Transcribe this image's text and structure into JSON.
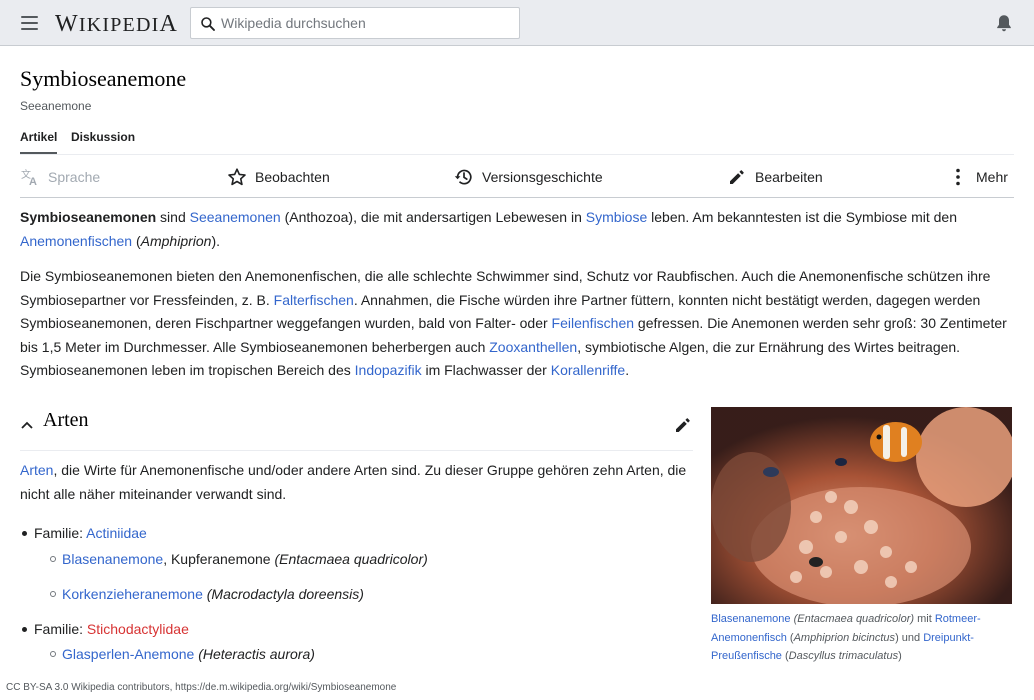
{
  "header": {
    "logo_text": "Wikipedia",
    "search_placeholder": "Wikipedia durchsuchen"
  },
  "page": {
    "title": "Symbioseanemone",
    "tagline": "Seeanemone"
  },
  "tabs": [
    {
      "label": "Artikel",
      "active": true
    },
    {
      "label": "Diskussion",
      "active": false
    }
  ],
  "actions": {
    "language": "Sprache",
    "watch": "Beobachten",
    "history": "Versionsgeschichte",
    "edit": "Bearbeiten",
    "more": "Mehr"
  },
  "intro": {
    "p1": {
      "bold": "Symbioseanemonen",
      "t1": " sind ",
      "l1": "Seeanemonen",
      "t2": " (Anthozoa), die mit andersartigen Lebewesen in ",
      "l2": "Symbiose",
      "t3": " leben. Am bekanntesten ist die Symbiose mit den ",
      "l3": "Anemonenfischen",
      "t4": " (",
      "i1": "Amphiprion",
      "t5": ")."
    },
    "p2": {
      "t1": "Die Symbioseanemonen bieten den Anemonenfischen, die alle schlechte Schwimmer sind, Schutz vor Raubfischen. Auch die Anemonenfische schützen ihre Symbiosepartner vor Fressfeinden, z. B. ",
      "l1": "Falterfischen",
      "t2": ". Annahmen, die Fische würden ihre Partner füttern, konnten nicht bestätigt werden, dagegen werden Symbioseanemonen, deren Fischpartner weggefangen wurden, bald von Falter- oder ",
      "l2": "Feilenfischen",
      "t3": " gefressen. Die Anemonen werden sehr groß: 30 Zentimeter bis 1,5 Meter im Durchmesser. Alle Symbioseanemonen beherbergen auch ",
      "l3": "Zooxanthellen",
      "t4": ", symbiotische Algen, die zur Ernährung des Wirtes beitragen. Symbioseanemonen leben im tropischen Bereich des ",
      "l4": "Indopazifik",
      "t5": " im Flachwasser der ",
      "l5": "Korallenriffe",
      "t6": "."
    }
  },
  "section": {
    "heading": "Arten",
    "text": {
      "l1": "Arten",
      "t1": ", die Wirte für Anemonenfische und/oder andere Arten sind. Zu dieser Gruppe gehören zehn Arten, die nicht alle näher miteinander verwandt sind."
    },
    "families": [
      {
        "prefix": "Familie: ",
        "name": "Actiniidae",
        "species": [
          {
            "link": "Blasenanemone",
            "plain": ", Kupferanemone ",
            "sci": "(Entacmaea quadricolor)"
          },
          {
            "link": "Korkenzieheranemone",
            "plain": " ",
            "sci": "(Macrodactyla doreensis)"
          }
        ]
      },
      {
        "prefix": "Familie: ",
        "name": "Stichodactylidae",
        "species": [
          {
            "link": "Glasperlen-Anemone",
            "plain": " ",
            "sci": "(Heteractis aurora)"
          }
        ]
      }
    ]
  },
  "figure": {
    "caption": {
      "l1": "Blasenanemone",
      "i1": "(Entacmaea quadricolor)",
      "t1": " mit ",
      "l2": "Rotmeer-Anemonenfisch",
      "t2": " (",
      "i2": "Amphiprion bicinctus",
      "t3": ") und ",
      "l3": "Dreipunkt-Preußenfische",
      "t4": " (",
      "i3": "Dascyllus trimaculatus",
      "t5": ")"
    }
  },
  "footer": {
    "license": "CC BY-SA 3.0 Wikipedia contributors, https://de.m.wikipedia.org/wiki/Symbioseanemone"
  },
  "colors": {
    "link": "#3366cc",
    "redlink": "#d73333",
    "header_bg": "#eaecf0"
  }
}
